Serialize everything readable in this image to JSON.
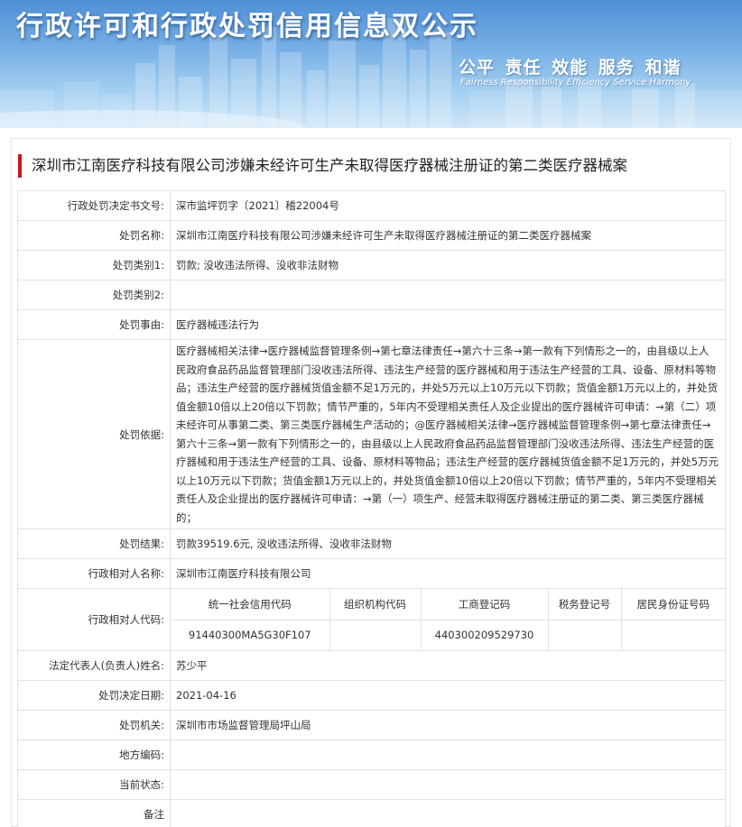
{
  "header": {
    "title": "行政许可和行政处罚信用信息双公示",
    "slogan": "公平  责任  效能  服务  和谐",
    "slogan_en": "Fairness  Responsibility  Efficiency  Service  Harmony"
  },
  "case_title": "深圳市江南医疗科技有限公司涉嫌未经许可生产未取得医疗器械注册证的第二类医疗器械案",
  "fields": {
    "doc_no": {
      "label": "行政处罚决定书文号:",
      "value": "深市监坪罚字〔2021〕稽22004号"
    },
    "name": {
      "label": "处罚名称:",
      "value": "深圳市江南医疗科技有限公司涉嫌未经许可生产未取得医疗器械注册证的第二类医疗器械案"
    },
    "category1": {
      "label": "处罚类别1:",
      "value": "罚款; 没收违法所得、没收非法财物"
    },
    "category2": {
      "label": "处罚类别2:",
      "value": ""
    },
    "reason": {
      "label": "处罚事由:",
      "value": "医疗器械违法行为"
    },
    "basis": {
      "label": "处罚依据:",
      "value": "医疗器械相关法律→医疗器械监督管理条例→第七章法律责任→第六十三条→第一款有下列情形之一的，由县级以上人民政府食品药品监督管理部门没收违法所得、违法生产经营的医疗器械和用于违法生产经营的工具、设备、原材料等物品；违法生产经营的医疗器械货值金额不足1万元的，并处5万元以上10万元以下罚款；货值金额1万元以上的，并处货值金额10倍以上20倍以下罚款；情节严重的，5年内不受理相关责任人及企业提出的医疗器械许可申请：→第（二）项未经许可从事第二类、第三类医疗器械生产活动的；@医疗器械相关法律→医疗器械监督管理条例→第七章法律责任→第六十三条→第一款有下列情形之一的，由县级以上人民政府食品药品监督管理部门没收违法所得、违法生产经营的医疗器械和用于违法生产经营的工具、设备、原材料等物品；违法生产经营的医疗器械货值金额不足1万元的，并处5万元以上10万元以下罚款；货值金额1万元以上的，并处货值金额10倍以上20倍以下罚款；情节严重的，5年内不受理相关责任人及企业提出的医疗器械许可申请：→第（一）项生产、经营未取得医疗器械注册证的第二类、第三类医疗器械的；"
    },
    "result": {
      "label": "处罚结果:",
      "value": "罚款39519.6元, 没收违法所得、没收非法财物"
    },
    "party_name": {
      "label": "行政相对人名称:",
      "value": "深圳市江南医疗科技有限公司"
    },
    "party_code": {
      "label": "行政相对人代码:",
      "headers": [
        "统一社会信用代码",
        "组织机构代码",
        "工商登记码",
        "税务登记号",
        "居民身份证号码"
      ],
      "values": [
        "91440300MA5G30F107",
        "",
        "440300209529730",
        "",
        ""
      ]
    },
    "legal_rep": {
      "label": "法定代表人(负责人)姓名:",
      "value": "苏少平"
    },
    "date": {
      "label": "处罚决定日期:",
      "value": "2021-04-16"
    },
    "authority": {
      "label": "处罚机关:",
      "value": "深圳市市场监督管理局坪山局"
    },
    "region_code": {
      "label": "地方编码:",
      "value": ""
    },
    "status": {
      "label": "当前状态:",
      "value": ""
    },
    "remark": {
      "label": "备注",
      "value": ""
    }
  },
  "colors": {
    "accent": "#c8161d",
    "banner_top": "#4f8fd6",
    "border": "#e2e2e2"
  }
}
